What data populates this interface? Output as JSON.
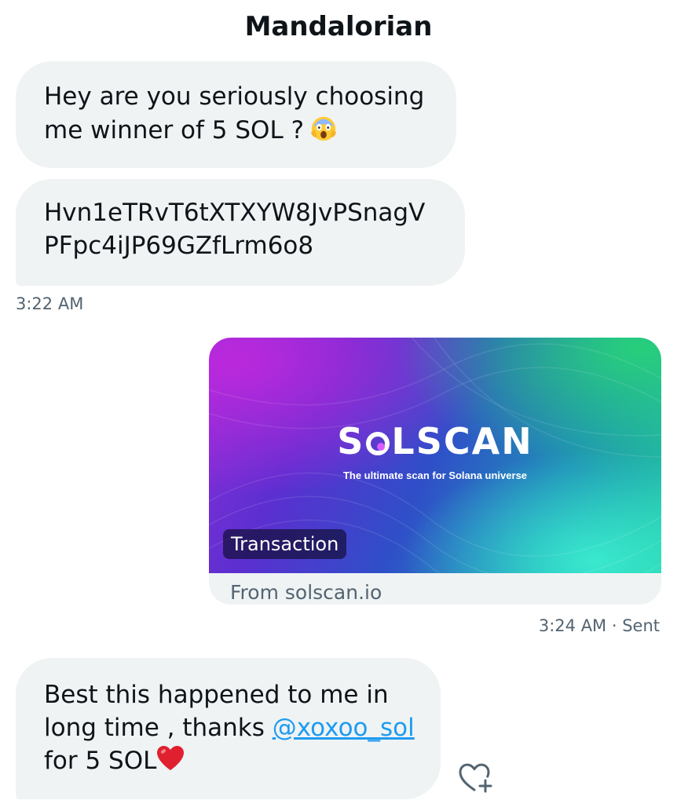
{
  "header": {
    "title": "Mandalorian"
  },
  "messages": [
    {
      "lines": [
        "Hey are you seriously choosing",
        "me winner of 5 SOL ?"
      ],
      "emoji": "face-screaming-in-fear"
    },
    {
      "lines": [
        "Hvn1eTRvT6tXTXYW8JvPSnagV",
        "PFpc4iJP69GZfLrm6o8"
      ]
    }
  ],
  "time_1": "3:22 AM",
  "link_card": {
    "logo_prefix": "S",
    "logo_suffix": "LSCAN",
    "tagline": "The ultimate scan for Solana universe",
    "label": "Transaction",
    "domain": "From solscan.io"
  },
  "time_2": "3:24 AM · Sent",
  "last_message": {
    "line1": "Best this happened to me in",
    "line2_prefix": "long time , thanks ",
    "mention": "@xoxoo_sol",
    "line3": "for 5 SOL",
    "emoji": "red-heart"
  },
  "icons": {
    "react": "heart-plus-icon"
  },
  "colors": {
    "bubble": "#eff3f4",
    "link": "#1d9bf0",
    "meta": "#536471"
  }
}
